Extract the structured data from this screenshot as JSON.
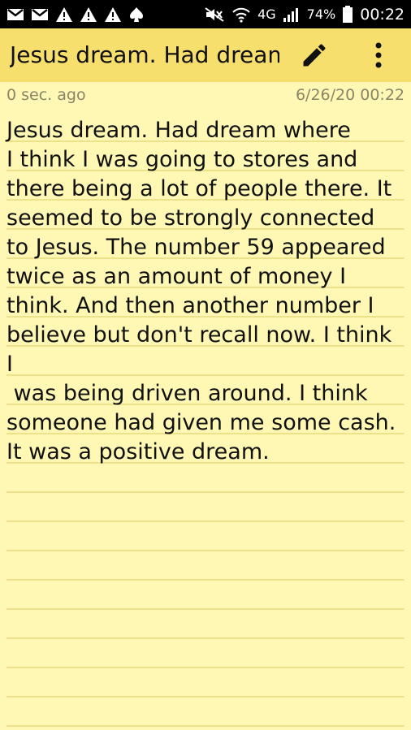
{
  "status_bar": {
    "left_icons": [
      "gmail-icon",
      "gmail-icon",
      "warning-icon",
      "warning-icon",
      "warning-icon",
      "spade-icon"
    ],
    "right_icons": [
      "mute-icon",
      "wifi-icon",
      "4g-icon",
      "signal-icon",
      "battery-icon"
    ],
    "network": "4G",
    "battery": "74%",
    "time": "00:22"
  },
  "app_bar": {
    "title": "Jesus dream. Had dream where",
    "background_color": "#f7df6e"
  },
  "meta": {
    "modified": "0 sec. ago",
    "date": "6/26/20 00:22"
  },
  "note": {
    "body": "Jesus dream. Had dream where\nI think I was going to stores and\nthere being a lot of people there. It\nseemed to be strongly connected\nto Jesus. The number 59 appeared\ntwice as an amount of money I\nthink. And then another number I\nbelieve but don't recall now. I think I\n was being driven around. I think\nsomeone had given me some cash.\nIt was a positive dream.",
    "paper_color": "#fff8b5",
    "line_color": "#efe08a"
  }
}
